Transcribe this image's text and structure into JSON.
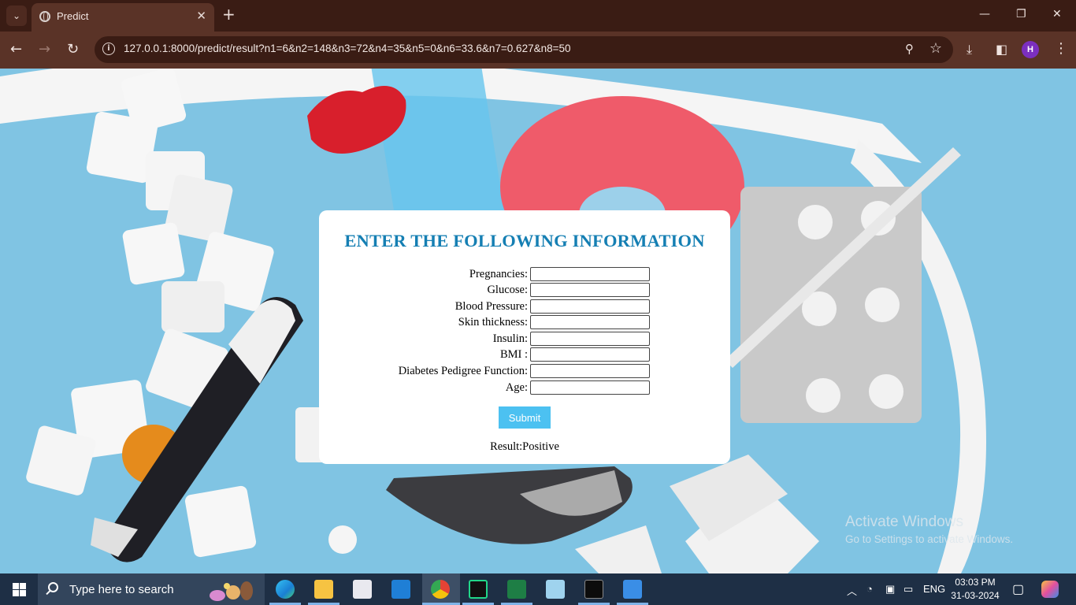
{
  "browser": {
    "tab_title": "Predict",
    "url": "127.0.0.1:8000/predict/result?n1=6&n2=148&n3=72&n4=35&n5=0&n6=33.6&n7=0.627&n8=50",
    "profile_initial": "H",
    "accent_color": "#5a3327"
  },
  "form": {
    "heading": "ENTER THE FOLLOWING INFORMATION",
    "fields": [
      {
        "label": "Pregnancies:",
        "value": ""
      },
      {
        "label": "Glucose:",
        "value": ""
      },
      {
        "label": "Blood Pressure:",
        "value": ""
      },
      {
        "label": "Skin thickness:",
        "value": ""
      },
      {
        "label": "Insulin:",
        "value": ""
      },
      {
        "label": "BMI :",
        "value": ""
      },
      {
        "label": "Diabetes Pedigree Function:",
        "value": ""
      },
      {
        "label": "Age:",
        "value": ""
      }
    ],
    "submit_label": "Submit",
    "result_label": "Result:",
    "result_value": "Positive",
    "heading_color": "#157fb3",
    "button_color": "#4cc1f1"
  },
  "watermark": {
    "title": "Activate Windows",
    "subtitle": "Go to Settings to activate Windows."
  },
  "taskbar": {
    "search_placeholder": "Type here to search",
    "language": "ENG",
    "time": "03:03 PM",
    "date": "31-03-2024"
  }
}
